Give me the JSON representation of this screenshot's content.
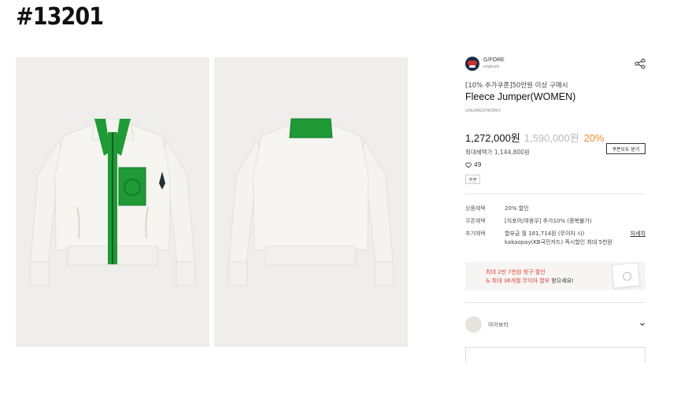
{
  "watermark": "#13201",
  "product": {
    "brand_name": "G/FORE",
    "brand_sub": "originals",
    "promo_text": "[10% 추가쿠폰]50만원 이상 구매시",
    "title": "Fleece Jumper(WOMEN)",
    "code": "GNUAW22403WX",
    "price_sale": "1,272,000원",
    "price_original": "1,590,000원",
    "discount_pct": "20%",
    "max_benefit": "최대혜택가 1,144,800원",
    "coupon_all_label": "쿠폰모두 받기",
    "likes": "49",
    "coupon_tag": "쿠폰"
  },
  "info": {
    "rows": [
      {
        "label": "상품혜택",
        "value": "20% 할인"
      },
      {
        "label": "쿠폰혜택",
        "value": "[지포어/여왕쿠] 추가10% (중복불가)"
      },
      {
        "label": "추가혜택",
        "value": "할부금 월 181,714원 (무이자 시)",
        "value2": "kakaopay(KB국민카드) 즉시할인 최대 5천원",
        "link": "자세히"
      }
    ]
  },
  "banner": {
    "line1": "최대 2만 7천원 청구 할인",
    "line2_highlight": "& 최대 36개월 무이자 할부",
    "line2_plain": " 받으세요!"
  },
  "option": {
    "color_label": "아이보리",
    "swatch_color": "#e8e4dd"
  },
  "colors": {
    "accent_orange": "#f08a2e",
    "accent_red": "#e2413a",
    "jacket_green": "#1f9a36",
    "fleece": "#f4f3ef"
  },
  "icons": [
    "share-icon",
    "heart-icon",
    "chevron-down-icon"
  ]
}
